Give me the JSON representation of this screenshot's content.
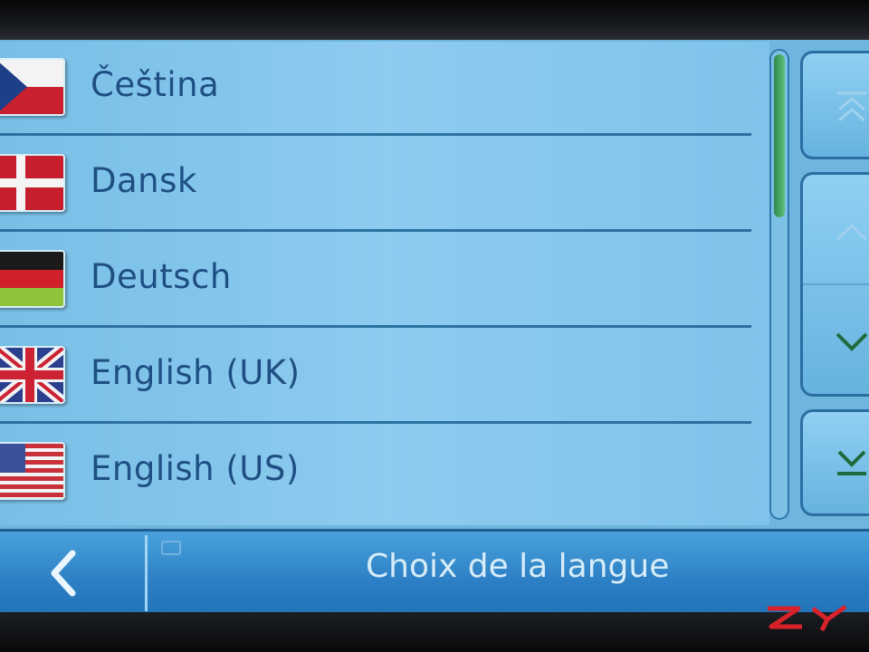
{
  "list": {
    "items": [
      {
        "label": "Čeština",
        "flag": "czech-flag-icon"
      },
      {
        "label": "Dansk",
        "flag": "danish-flag-icon"
      },
      {
        "label": "Deutsch",
        "flag": "german-flag-icon"
      },
      {
        "label": "English (UK)",
        "flag": "uk-flag-icon"
      },
      {
        "label": "English (US)",
        "flag": "us-flag-icon"
      }
    ]
  },
  "scroll_buttons": [
    "page-up-icon",
    "arrow-up-icon",
    "arrow-down-icon",
    "page-down-icon"
  ],
  "footer": {
    "title": "Choix de la langue",
    "back_icon": "chevron-left-icon"
  },
  "colors": {
    "list_bg": "#8dcbef",
    "text": "#1f4f82",
    "footer_bg": "#2c7fc4",
    "scroll_thumb": "#3fa860"
  }
}
